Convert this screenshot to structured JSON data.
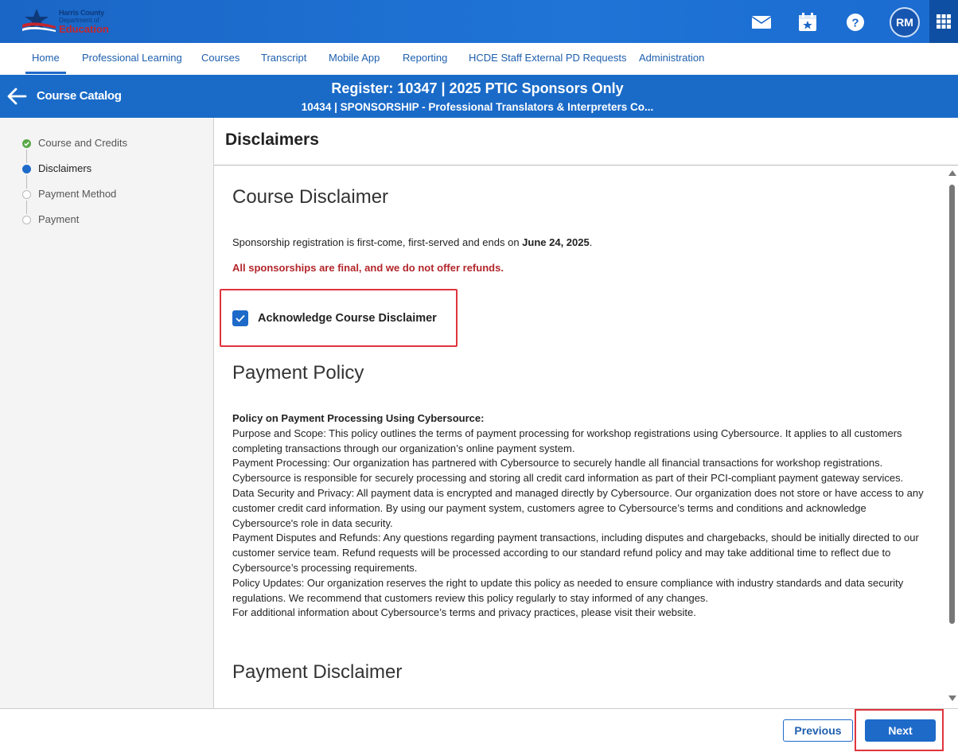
{
  "brand": {
    "line1": "Harris County",
    "line2": "Department of",
    "line3": "Education"
  },
  "header": {
    "avatar_initials": "RM",
    "icons": [
      "mail-icon",
      "calendar-star-icon",
      "help-icon",
      "apps-grid-icon"
    ]
  },
  "nav": {
    "items": [
      {
        "label": "Home",
        "active": true
      },
      {
        "label": "Professional Learning"
      },
      {
        "label": "Courses"
      },
      {
        "label": "Transcript"
      },
      {
        "label": "Mobile App"
      },
      {
        "label": "Reporting"
      },
      {
        "label": "HCDE Staff External PD Requests"
      },
      {
        "label": "Administration"
      }
    ]
  },
  "banner": {
    "back_label": "Course Catalog",
    "title": "Register: 10347 | 2025 PTIC Sponsors Only",
    "subtitle": "10434 | SPONSORSHIP - Professional Translators & Interpreters Co..."
  },
  "steps": [
    {
      "label": "Course and Credits",
      "state": "complete"
    },
    {
      "label": "Disclaimers",
      "state": "current"
    },
    {
      "label": "Payment Method",
      "state": "pending"
    },
    {
      "label": "Payment",
      "state": "pending"
    }
  ],
  "page": {
    "title": "Disclaimers"
  },
  "course_disclaimer": {
    "title": "Course Disclaimer",
    "text_before": "Sponsorship registration is first-come, first-served and ends on ",
    "text_date": "June 24, 2025",
    "text_after": ".",
    "warning": "All sponsorships are final, and we do not offer refunds.",
    "ack_label": "Acknowledge Course Disclaimer",
    "ack_checked": true
  },
  "payment_policy": {
    "title": "Payment Policy",
    "heading": "Policy on Payment Processing Using Cybersource:",
    "paragraphs": [
      "Purpose and Scope: This policy outlines the terms of payment processing for workshop registrations using Cybersource. It applies to all customers completing transactions through our organization’s online payment system.",
      "Payment Processing: Our organization has partnered with Cybersource to securely handle all financial transactions for workshop registrations. Cybersource is responsible for securely processing and storing all credit card information as part of their PCI-compliant payment gateway services.",
      "Data Security and Privacy: All payment data is encrypted and managed directly by Cybersource. Our organization does not store or have access to any customer credit card information. By using our payment system, customers agree to Cybersource’s terms and conditions and acknowledge Cybersource's role in data security.",
      "Payment Disputes and Refunds: Any questions regarding payment transactions, including disputes and chargebacks, should be initially directed to our customer service team. Refund requests will be processed according to our standard refund policy and may take additional time to reflect due to Cybersource’s processing requirements.",
      "Policy Updates: Our organization reserves the right to update this policy as needed to ensure compliance with industry standards and data security regulations. We recommend that customers review this policy regularly to stay informed of any changes.",
      "For additional information about Cybersource’s terms and privacy practices, please visit their website."
    ]
  },
  "payment_disclaimer": {
    "title": "Payment Disclaimer"
  },
  "footer": {
    "previous_label": "Previous",
    "next_label": "Next"
  },
  "colors": {
    "brand_blue": "#1a6bc8",
    "warning_red": "#b3262b",
    "highlight_red": "#e0343d",
    "step_complete": "#5aa84a"
  }
}
